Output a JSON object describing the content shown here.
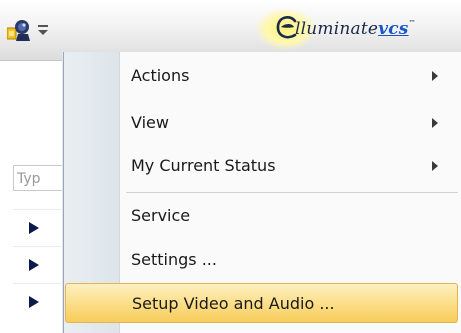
{
  "toolbar": {
    "app_icon": "elluminate-app-icon",
    "quick_access_icon": "quick-access-dropdown-icon",
    "logo": {
      "icon": "elluminate-e-logo-icon",
      "brand_prefix": "lluminate",
      "brand_suffix": "vcs",
      "trademark": "™",
      "glow_color": "#fff27a"
    }
  },
  "left_panel": {
    "column_header": "Typ",
    "row_icon": "play-arrow-icon",
    "rows": 3
  },
  "menu": {
    "items": [
      {
        "label": "Actions",
        "submenu": true
      },
      {
        "label": "View",
        "submenu": true
      },
      {
        "label": "My Current Status",
        "submenu": true
      },
      {
        "label": "Service",
        "submenu": false
      },
      {
        "label": "Settings ...",
        "submenu": false
      },
      {
        "label": "Setup Video and Audio ...",
        "submenu": false,
        "highlighted": true
      }
    ],
    "submenu_icon": "chevron-right-icon",
    "highlight_color": "#f9d673",
    "gutter_color": "#e3eaee"
  }
}
